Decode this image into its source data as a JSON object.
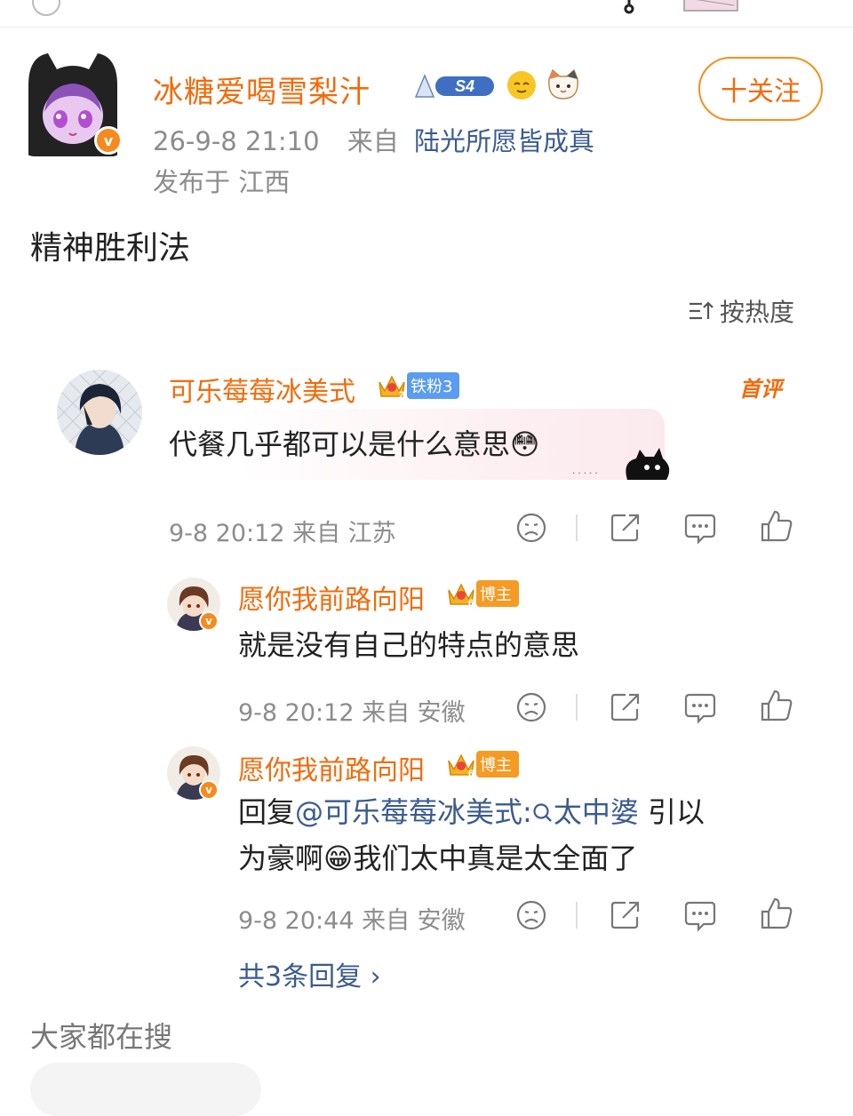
{
  "post": {
    "author": "冰糖爱喝雪梨汁",
    "level_badge": "S4",
    "date_time": "26-9-8 21:10",
    "from_prefix": "来自",
    "source": "陆光所愿皆成真",
    "location": "发布于 江西",
    "follow_label": "十关注",
    "text": "精神胜利法"
  },
  "sort_label": "按热度",
  "comments": [
    {
      "name": "可乐莓莓冰美式",
      "badge_level": "2",
      "badge_label": "铁粉3",
      "first_tag": "首评",
      "text": "代餐几乎都可以是什么意思😳",
      "meta": "9-8 20:12 来自 江苏"
    }
  ],
  "replies": [
    {
      "name": "愿你我前路向阳",
      "badge_level": "6",
      "badge_label": "博主",
      "text": "就是没有自己的特点的意思",
      "meta": "9-8 20:12 来自 安徽"
    },
    {
      "name": "愿你我前路向阳",
      "badge_level": "6",
      "badge_label": "博主",
      "reply_prefix": "回复",
      "reply_mention": "@可乐莓莓冰美式",
      "reply_colon": ":",
      "reply_topic": "太中婆",
      "text_line1_end": " 引以",
      "text_line2": "为豪啊😁我们太中真是太全面了",
      "meta": "9-8 20:44 来自 安徽"
    }
  ],
  "more_replies": "共3条回复 ›",
  "search_title": "大家都在搜",
  "colors": {
    "accent_orange": "#f26b0b",
    "link_blue": "#3b5b8f",
    "meta_gray": "#8c8c8c"
  },
  "icons": [
    "dislike-icon",
    "share-icon",
    "comment-icon",
    "like-icon",
    "sort-icon",
    "search-icon"
  ]
}
